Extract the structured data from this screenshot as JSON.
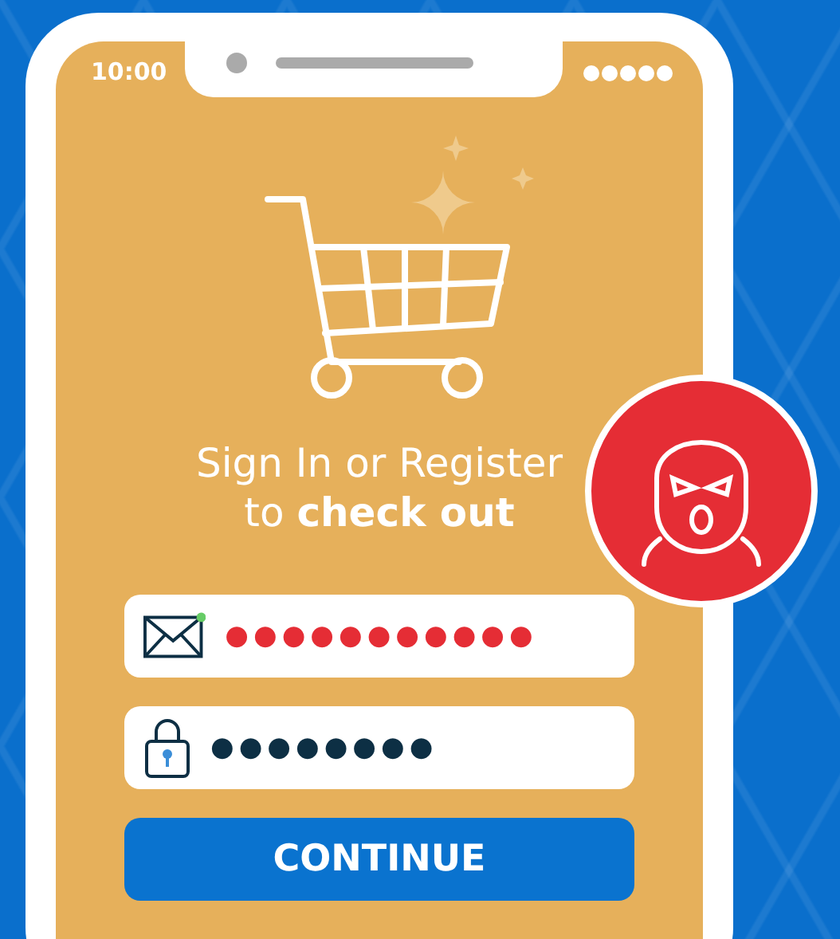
{
  "status_bar": {
    "time": "10:00"
  },
  "heading_lines": [
    "Sign In or Register",
    "to **check out**"
  ],
  "fields": [
    {
      "kind": "email",
      "value": "●●●●●●●●●●●"
    },
    {
      "kind": "password",
      "value": "●●●●●●●●"
    }
  ],
  "button": "CONTINUE"
}
